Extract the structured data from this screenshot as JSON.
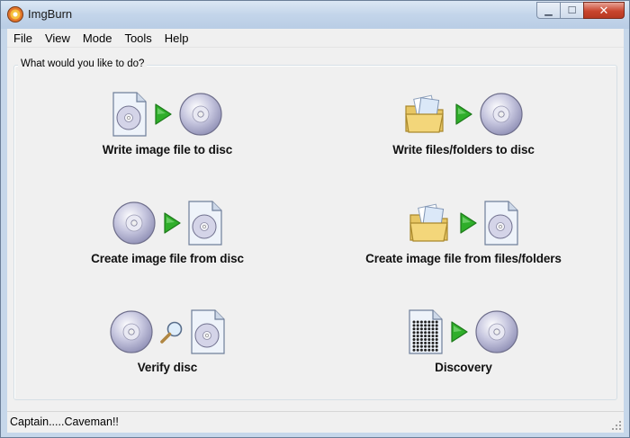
{
  "window": {
    "title": "ImgBurn"
  },
  "caption": {
    "minimize": "▁",
    "maximize": "☐",
    "close": "✕"
  },
  "menu": [
    "File",
    "View",
    "Mode",
    "Tools",
    "Help"
  ],
  "group_label": "What would you like to do?",
  "actions": [
    {
      "label": "Write image file to disc",
      "icons": [
        "image-file-icon",
        "arrow-icon",
        "disc-icon"
      ]
    },
    {
      "label": "Write files/folders to disc",
      "icons": [
        "folder-icon",
        "arrow-icon",
        "disc-icon"
      ]
    },
    {
      "label": "Create image file from disc",
      "icons": [
        "disc-icon",
        "arrow-icon",
        "image-file-icon"
      ]
    },
    {
      "label": "Create image file from files/folders",
      "icons": [
        "folder-icon",
        "arrow-icon",
        "image-file-icon"
      ]
    },
    {
      "label": "Verify disc",
      "icons": [
        "disc-icon",
        "magnifier-icon",
        "image-file-icon"
      ]
    },
    {
      "label": "Discovery",
      "icons": [
        "data-grid-icon",
        "arrow-icon",
        "disc-icon"
      ]
    }
  ],
  "status": {
    "text": "Captain.....Caveman!!"
  },
  "colors": {
    "arrow": "#2fae2a",
    "disc": "#c8c8e0",
    "folder": "#f3d67a"
  }
}
